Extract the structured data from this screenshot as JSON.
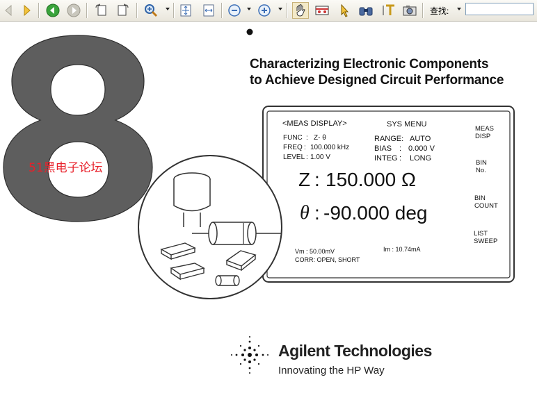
{
  "toolbar": {
    "buttons": [
      "back-icon",
      "forward-icon",
      "prev-view-icon",
      "next-view-icon",
      "rotate-cw-icon",
      "rotate-ccw-icon",
      "zoom-in-icon",
      "fit-page-icon",
      "fit-width-icon",
      "zoom-out-icon",
      "zoom-plus-icon",
      "hand-tool-icon",
      "snapshot-icon",
      "select-icon",
      "find-icon",
      "text-select-icon",
      "camera-icon"
    ],
    "find_label": "查找:",
    "find_value": ""
  },
  "cover": {
    "chapter_number": "8",
    "bullet": "•",
    "title_line1": "Characterizing Electronic Components",
    "title_line2": "to Achieve Designed Circuit Performance",
    "watermark": "51黑电子论坛"
  },
  "display": {
    "header_left": "<MEAS DISPLAY>",
    "header_right": "SYS MENU",
    "func_label": "FUNC",
    "func_value": "Z- θ",
    "freq_label": "FREQ",
    "freq_value": "100.000 kHz",
    "level_label": "LEVEL",
    "level_value": "1.00 V",
    "range_label": "RANGE:",
    "range_value": "AUTO",
    "bias_label": "BIAS",
    "bias_value": "0.000  V",
    "integ_label": "INTEG",
    "integ_value": "LONG",
    "z_label": "Z",
    "z_value": "150.000 Ω",
    "theta_label": "θ",
    "theta_value": "-90.000 deg",
    "vm": "Vm  :  50.00mV",
    "im": "Im  :  10.74mA",
    "corr": "CORR: OPEN, SHORT",
    "side_menu": [
      {
        "line1": "MEAS",
        "line2": "DISP"
      },
      {
        "line1": "BIN",
        "line2": "No."
      },
      {
        "line1": "BIN",
        "line2": "COUNT"
      },
      {
        "line1": "LIST",
        "line2": "SWEEP"
      }
    ]
  },
  "brand": {
    "name": "Agilent Technologies",
    "tagline": "Innovating the HP Way"
  }
}
